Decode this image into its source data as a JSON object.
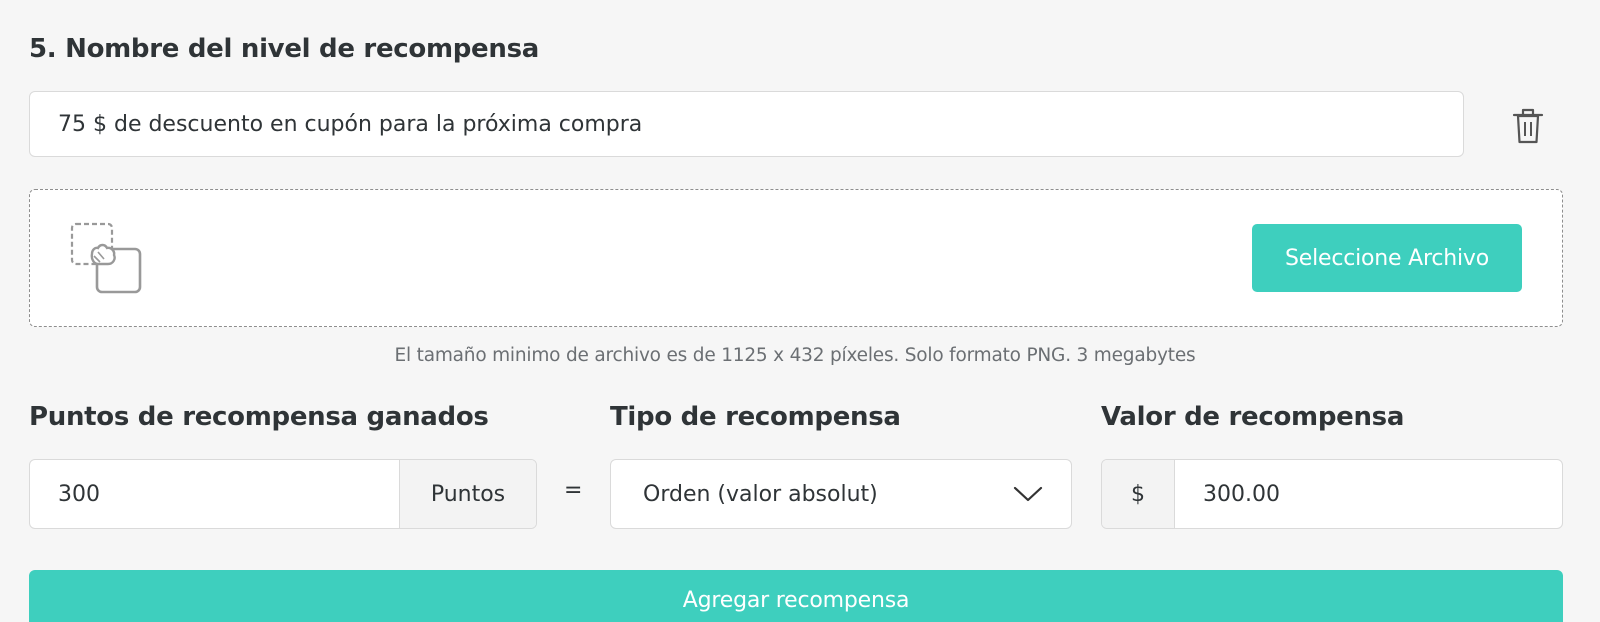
{
  "tier": {
    "title": "5. Nombre del nivel de recompensa",
    "name_value": "75 $ de descuento en cupón para la próxima compra"
  },
  "icons": {
    "delete": "trash-icon",
    "upload": "image-upload-icon",
    "dropdown": "chevron-down-icon"
  },
  "upload": {
    "button_label": "Seleccione Archivo",
    "hint": "El tamaño minimo de archivo es de 1125 x 432 píxeles. Solo formato PNG. 3 megabytes"
  },
  "fields": {
    "points": {
      "label": "Puntos de recompensa ganados",
      "value": "300",
      "suffix": "Puntos"
    },
    "equals": "=",
    "reward_type": {
      "label": "Tipo de recompensa",
      "selected": "Orden (valor absolut)"
    },
    "reward_value": {
      "label": "Valor de recompensa",
      "prefix": "$",
      "value": "300.00"
    }
  },
  "actions": {
    "add_label": "Agregar recompensa"
  },
  "colors": {
    "accent": "#3ecfbe",
    "background": "#f6f6f6",
    "border": "#dadada"
  }
}
